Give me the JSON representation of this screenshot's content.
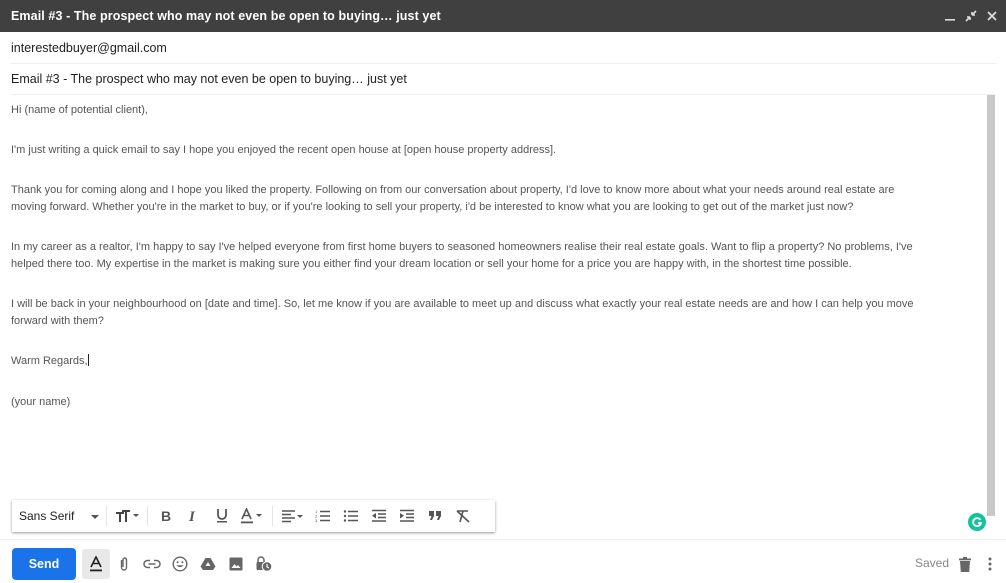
{
  "window": {
    "title": "Email #3 - The prospect who may not even be open to buying… just yet",
    "controls": [
      {
        "name": "minimize-icon"
      },
      {
        "name": "exit-fullscreen-icon"
      },
      {
        "name": "close-icon"
      }
    ]
  },
  "compose": {
    "to": "interestedbuyer@gmail.com",
    "subject": "Email #3 - The prospect who may not even be open to buying… just yet",
    "body": {
      "greeting": "Hi (name of potential client),",
      "p1": "I'm just writing a quick email to say I hope you enjoyed the recent open house at [open house property address].",
      "p2_line1": "Thank you for coming along and I hope you liked the property. Following on from our conversation about property,  I'd love to know more about what your needs around real estate are",
      "p2_line2": "moving forward. Whether you're in the market to buy, or if you're looking to sell your property, i'd be interested to know what you are looking to get out of the market just now?",
      "p3_line1": "In my career as a realtor, I'm happy to say I've helped everyone from first home buyers to seasoned homeowners realise their real estate goals. Want to flip a property? No problems, I've",
      "p3_line2": "helped there too. My expertise in the market is making sure you either find your dream location or sell your home for a price you are happy with, in the shortest time possible.",
      "p4_line1": "I will be back in your neighbourhood on [date and time]. So, let me know if you are available to meet up and discuss what exactly your real estate needs are and how I can help you move",
      "p4_line2": "forward with them?",
      "signoff": "Warm Regards,",
      "signature": "(your name)"
    }
  },
  "format_toolbar": {
    "font": "Sans Serif",
    "buttons": [
      "font-size",
      "bold",
      "italic",
      "underline",
      "text-color",
      "align",
      "numbered-list",
      "bulleted-list",
      "indent-less",
      "indent-more",
      "quote",
      "remove-formatting"
    ]
  },
  "bottom_bar": {
    "send_label": "Send",
    "status": "Saved",
    "icons": [
      "formatting-options",
      "attach-files",
      "insert-link",
      "insert-emoji",
      "insert-drive-file",
      "insert-photo",
      "confidential-mode"
    ]
  },
  "colors": {
    "titlebar": "#404040",
    "send": "#1a73e8",
    "grammarly": "#15c39a"
  }
}
